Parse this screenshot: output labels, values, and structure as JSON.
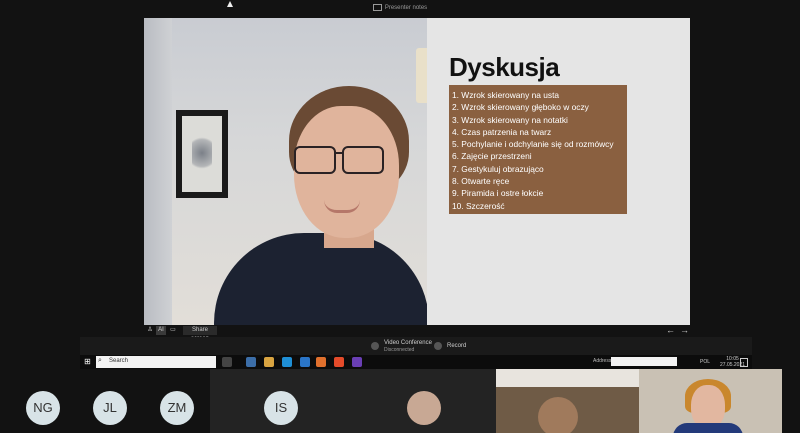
{
  "presenter_notes": {
    "label": "Presenter notes"
  },
  "slide": {
    "title": "Dyskusja",
    "box_color": "#8a6040",
    "items": [
      "1. Wzrok skierowany na usta",
      "2. Wzrok skierowany głęboko w oczy",
      "3. Wzrok skierowany na notatki",
      "4. Czas patrzenia na twarz",
      "5. Pochylanie i odchylanie się od rozmówcy",
      "6. Zajęcie przestrzeni",
      "7. Gestykuluj obrazująco",
      "8. Otwarte ręce",
      "9. Piramida i ostre łokcie",
      "10. Szczerość"
    ]
  },
  "stage_toolbar": {
    "share_screen": "Share screen",
    "arrow_left": "←",
    "arrow_right": "→"
  },
  "video_conference": {
    "title": "Video Conference",
    "status": "Disconnected",
    "record": "Record"
  },
  "taskbar": {
    "search_placeholder": "Search",
    "address_label": "Address",
    "language": "POL",
    "time": "10:05",
    "date": "27.05.2021"
  },
  "gallery": {
    "participants": [
      "NG",
      "JL",
      "ZM",
      "IS"
    ]
  }
}
